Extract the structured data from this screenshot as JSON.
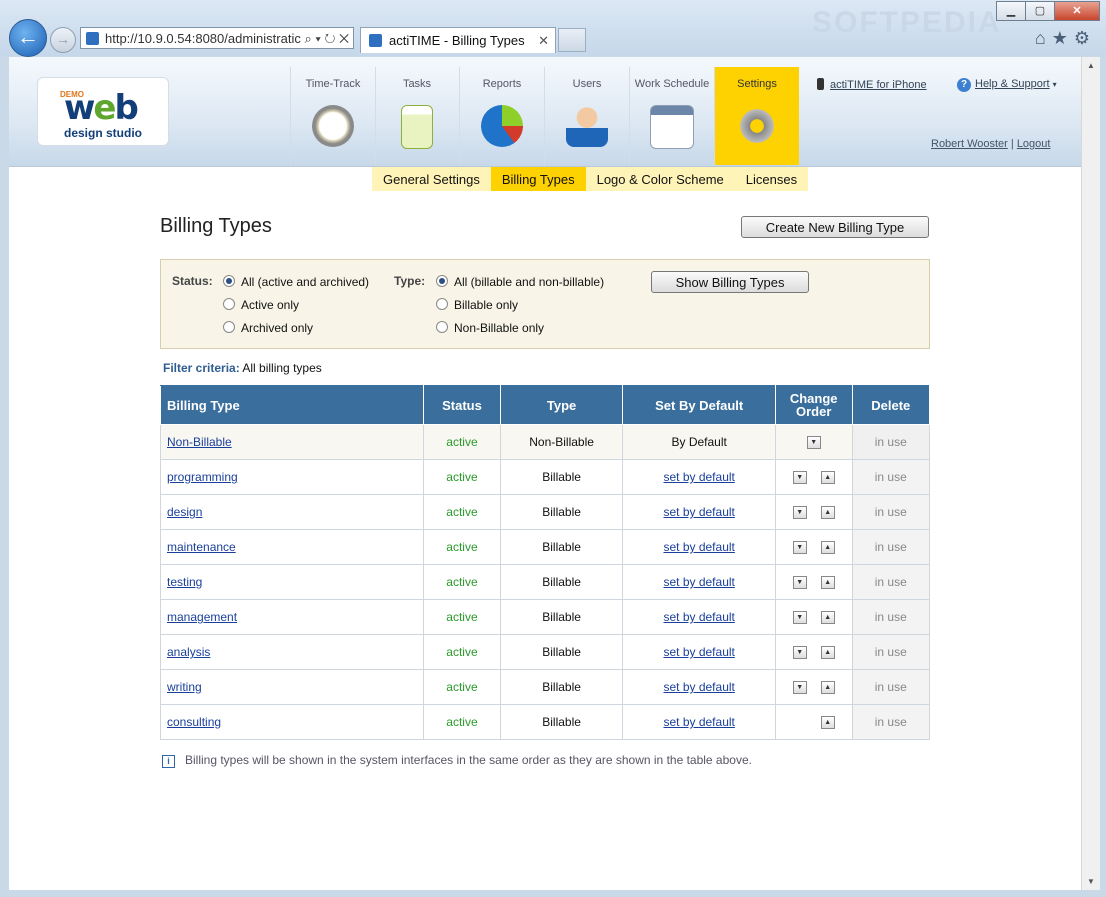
{
  "browser": {
    "url": "http://10.9.0.54:8080/administratic",
    "tab_title": "actiTIME - Billing Types",
    "watermark": "SOFTPEDIA"
  },
  "logo": {
    "demo": "DEMO",
    "web": "web",
    "studio": "design studio"
  },
  "nav": [
    {
      "label": "Time-Track",
      "icon": "stopwatch-icon"
    },
    {
      "label": "Tasks",
      "icon": "clipboard-icon"
    },
    {
      "label": "Reports",
      "icon": "pie-chart-icon"
    },
    {
      "label": "Users",
      "icon": "user-icon"
    },
    {
      "label": "Work Schedule",
      "icon": "calendar-icon"
    },
    {
      "label": "Settings",
      "icon": "gears-icon",
      "active": true
    }
  ],
  "header": {
    "iphone": "actiTIME for iPhone",
    "help": "Help & Support",
    "user_name": "Robert Wooster",
    "logout": "Logout"
  },
  "subnav": [
    {
      "label": "General Settings"
    },
    {
      "label": "Billing Types",
      "active": true
    },
    {
      "label": "Logo & Color Scheme"
    },
    {
      "label": "Licenses"
    }
  ],
  "page": {
    "title": "Billing Types",
    "create_button": "Create New Billing Type"
  },
  "filter": {
    "status_label": "Status:",
    "status_options": [
      "All (active and archived)",
      "Active only",
      "Archived only"
    ],
    "status_selected": 0,
    "type_label": "Type:",
    "type_options": [
      "All (billable and non-billable)",
      "Billable only",
      "Non-Billable only"
    ],
    "type_selected": 0,
    "show_button": "Show Billing Types",
    "criteria_label": "Filter criteria:",
    "criteria_value": "All billing types"
  },
  "table": {
    "headers": [
      "Billing Type",
      "Status",
      "Type",
      "Set By Default",
      "Change Order",
      "Delete"
    ],
    "rows": [
      {
        "name": "Non-Billable",
        "status": "active",
        "type": "Non-Billable",
        "default": "By Default",
        "down": true,
        "up": false,
        "delete": "in use"
      },
      {
        "name": "programming",
        "status": "active",
        "type": "Billable",
        "default": "set by default",
        "down": true,
        "up": true,
        "delete": "in use"
      },
      {
        "name": "design",
        "status": "active",
        "type": "Billable",
        "default": "set by default",
        "down": true,
        "up": true,
        "delete": "in use"
      },
      {
        "name": "maintenance",
        "status": "active",
        "type": "Billable",
        "default": "set by default",
        "down": true,
        "up": true,
        "delete": "in use"
      },
      {
        "name": "testing",
        "status": "active",
        "type": "Billable",
        "default": "set by default",
        "down": true,
        "up": true,
        "delete": "in use"
      },
      {
        "name": "management",
        "status": "active",
        "type": "Billable",
        "default": "set by default",
        "down": true,
        "up": true,
        "delete": "in use"
      },
      {
        "name": "analysis",
        "status": "active",
        "type": "Billable",
        "default": "set by default",
        "down": true,
        "up": true,
        "delete": "in use"
      },
      {
        "name": "writing",
        "status": "active",
        "type": "Billable",
        "default": "set by default",
        "down": true,
        "up": true,
        "delete": "in use"
      },
      {
        "name": "consulting",
        "status": "active",
        "type": "Billable",
        "default": "set by default",
        "down": false,
        "up": true,
        "delete": "in use"
      }
    ]
  },
  "note": "Billing types will be shown in the system interfaces in the same order as they are shown in the table above."
}
